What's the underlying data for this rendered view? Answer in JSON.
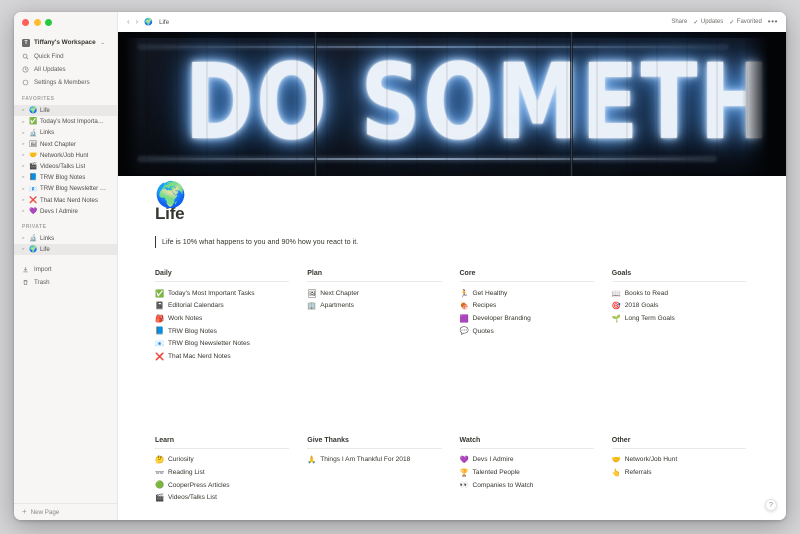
{
  "window": {
    "traffic_lights": [
      "close",
      "minimize",
      "zoom"
    ]
  },
  "sidebar": {
    "workspace": {
      "name": "Tiffany's Workspace",
      "icon": "workspace-icon",
      "caret": "⌄"
    },
    "nav": [
      {
        "label": "Quick Find",
        "icon": "search-icon"
      },
      {
        "label": "All Updates",
        "icon": "clock-icon"
      },
      {
        "label": "Settings & Members",
        "icon": "gear-icon"
      }
    ],
    "favorites_label": "FAVORITES",
    "favorites": [
      {
        "label": "Life",
        "emoji": "🌍",
        "active": true
      },
      {
        "label": "Today's Most Importa…",
        "emoji": "✅",
        "active": false
      },
      {
        "label": "Links",
        "emoji": "🔬",
        "active": false
      },
      {
        "label": "Next Chapter",
        "emoji": "🖼",
        "active": false
      },
      {
        "label": "Network/Job Hunt",
        "emoji": "🤝",
        "active": false
      },
      {
        "label": "Videos/Talks List",
        "emoji": "🎬",
        "active": false
      },
      {
        "label": "TRW Blog Notes",
        "emoji": "📘",
        "active": false
      },
      {
        "label": "TRW Blog Newsletter …",
        "emoji": "📧",
        "active": false
      },
      {
        "label": "That Mac Nerd Notes",
        "emoji": "❌",
        "active": false
      },
      {
        "label": "Devs I Admire",
        "emoji": "💜",
        "active": false
      }
    ],
    "private_label": "PRIVATE",
    "private": [
      {
        "label": "Links",
        "emoji": "🔬",
        "active": false
      },
      {
        "label": "Life",
        "emoji": "🌍",
        "active": true
      }
    ],
    "bottom_nav": [
      {
        "label": "Import",
        "icon": "download-icon"
      },
      {
        "label": "Trash",
        "icon": "trash-icon"
      }
    ],
    "new_page": {
      "label": "New Page",
      "icon": "plus-icon"
    }
  },
  "topbar": {
    "back": "‹",
    "forward": "›",
    "breadcrumb_emoji": "🌍",
    "breadcrumb": "Life",
    "share": "Share",
    "updates": "Updates",
    "favorited": "Favorited",
    "check": "✓",
    "more": "•••"
  },
  "hero": {
    "alt": "neon-sign-cover-image",
    "text": "DO SOMETHING GREAT"
  },
  "page": {
    "emoji": "🌍",
    "title": "Life",
    "quote": "Life is 10% what happens to you and 90% how you react to it."
  },
  "columns_row1": [
    {
      "heading": "Daily",
      "items": [
        {
          "emoji": "✅",
          "label": "Today's Most Important Tasks"
        },
        {
          "emoji": "📓",
          "label": "Editorial Calendars"
        },
        {
          "emoji": "🎒",
          "label": "Work Notes"
        },
        {
          "emoji": "📘",
          "label": "TRW Blog Notes"
        },
        {
          "emoji": "📧",
          "label": "TRW Blog Newsletter Notes"
        },
        {
          "emoji": "❌",
          "label": "That Mac Nerd Notes"
        }
      ]
    },
    {
      "heading": "Plan",
      "items": [
        {
          "emoji": "🖼",
          "label": "Next Chapter"
        },
        {
          "emoji": "🏢",
          "label": "Apartments"
        }
      ]
    },
    {
      "heading": "Core",
      "items": [
        {
          "emoji": "🏃",
          "label": "Get Healthy"
        },
        {
          "emoji": "🍖",
          "label": "Recipes"
        },
        {
          "emoji": "🟪",
          "label": "Developer Branding"
        },
        {
          "emoji": "💬",
          "label": "Quotes"
        }
      ]
    },
    {
      "heading": "Goals",
      "items": [
        {
          "emoji": "📖",
          "label": "Books to Read"
        },
        {
          "emoji": "🎯",
          "label": "2018 Goals"
        },
        {
          "emoji": "🌱",
          "label": "Long Term Goals"
        }
      ]
    }
  ],
  "columns_row2": [
    {
      "heading": "Learn",
      "items": [
        {
          "emoji": "🤔",
          "label": "Curiosity"
        },
        {
          "emoji": "👓",
          "label": "Reading List"
        },
        {
          "emoji": "🟢",
          "label": "CooperPress Articles"
        },
        {
          "emoji": "🎬",
          "label": "Videos/Talks List"
        }
      ]
    },
    {
      "heading": "Give Thanks",
      "items": [
        {
          "emoji": "🙏",
          "label": "Things I Am Thankful For 2018"
        }
      ]
    },
    {
      "heading": "Watch",
      "items": [
        {
          "emoji": "💜",
          "label": "Devs I Admire"
        },
        {
          "emoji": "🏆",
          "label": "Talented People"
        },
        {
          "emoji": "👀",
          "label": "Companies to Watch"
        }
      ]
    },
    {
      "heading": "Other",
      "items": [
        {
          "emoji": "🤝",
          "label": "Network/Job Hunt"
        },
        {
          "emoji": "👆",
          "label": "Referrals"
        }
      ]
    }
  ],
  "help_button": {
    "label": "?"
  },
  "colors": {
    "sidebar_bg": "#f7f6f5",
    "text": "#37352f",
    "muted": "#9b9a97",
    "hero_bg": "#07080b",
    "neon": "#f2f8ff"
  }
}
